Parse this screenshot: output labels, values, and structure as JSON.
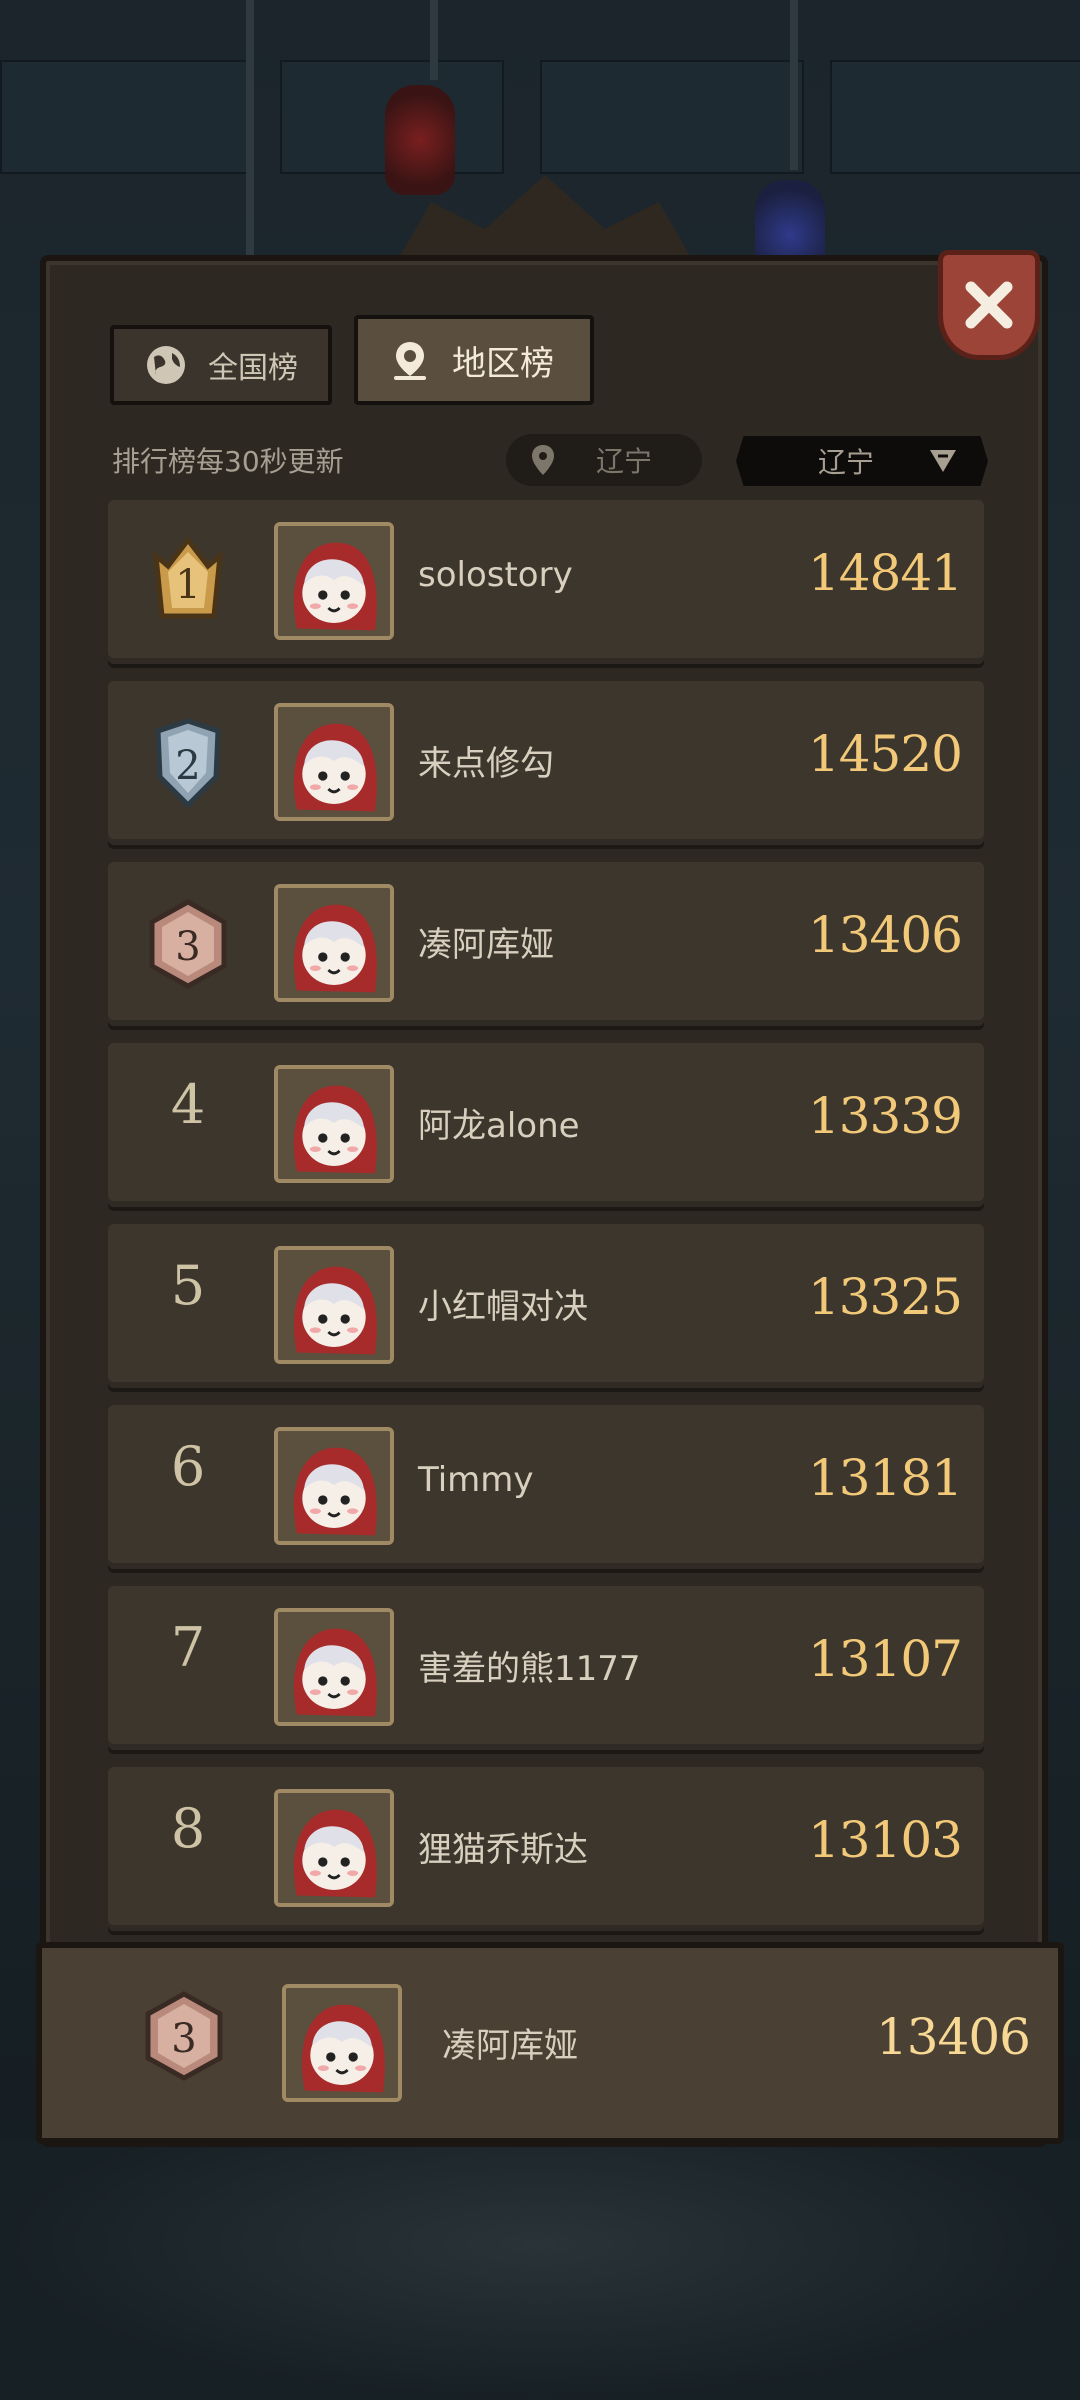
{
  "tabs": {
    "national": "全国榜",
    "region": "地区榜"
  },
  "update_note": "排行榜每30秒更新",
  "location_pill": "辽宁",
  "location_select": "辽宁",
  "rankings": [
    {
      "rank": "1",
      "badge": "gold",
      "name": "solostory",
      "score": "14841"
    },
    {
      "rank": "2",
      "badge": "silver",
      "name": "来点修勾",
      "score": "14520"
    },
    {
      "rank": "3",
      "badge": "bronze",
      "name": "凑阿库娅",
      "score": "13406"
    },
    {
      "rank": "4",
      "badge": "",
      "name": "阿龙alone",
      "score": "13339"
    },
    {
      "rank": "5",
      "badge": "",
      "name": "小红帽对决",
      "score": "13325"
    },
    {
      "rank": "6",
      "badge": "",
      "name": "Timmy",
      "score": "13181"
    },
    {
      "rank": "7",
      "badge": "",
      "name": "害羞的熊1177",
      "score": "13107"
    },
    {
      "rank": "8",
      "badge": "",
      "name": "狸猫乔斯达",
      "score": "13103"
    }
  ],
  "self": {
    "rank": "3",
    "badge": "bronze",
    "name": "凑阿库娅",
    "score": "13406"
  },
  "colors": {
    "gold": "#c89a4a",
    "silver": "#8fa3b2",
    "bronze": "#b98a7c",
    "score": "#f2c978",
    "close": "#9b4437"
  },
  "icons": {
    "close": "close-icon",
    "globe": "globe-icon",
    "pin": "location-pin-icon",
    "dropdown": "dropdown-arrow-icon",
    "avatar": "red-hood-avatar"
  }
}
